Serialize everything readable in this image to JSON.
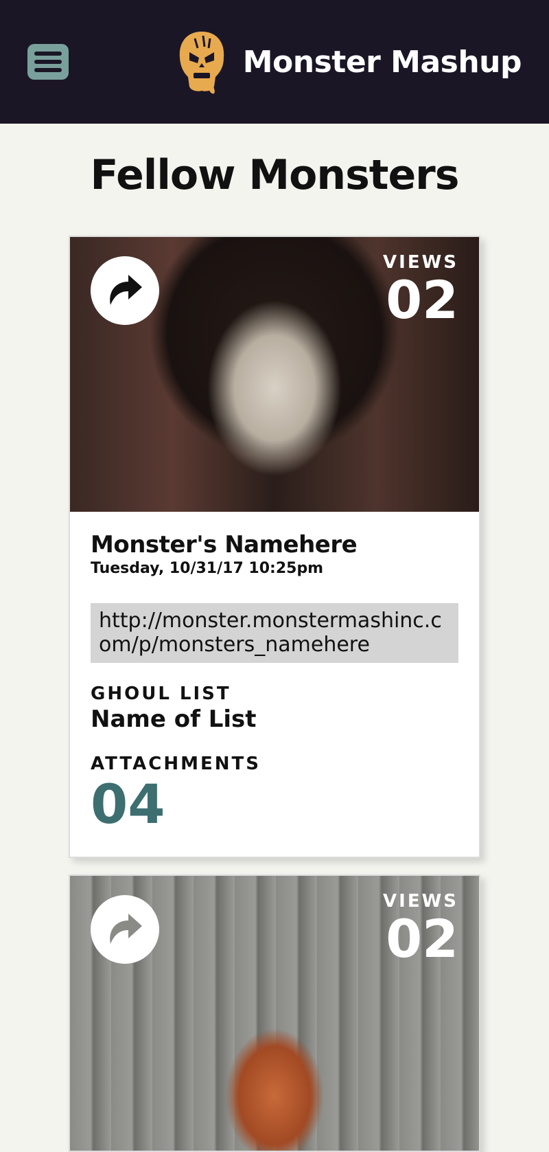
{
  "header": {
    "brand_name": "Monster Mashup",
    "logo_icon": "skull-logo-icon",
    "menu_icon": "hamburger-menu-icon",
    "colors": {
      "bar": "#1a1626",
      "menu": "#7aa09c",
      "logo": "#e7aa4e"
    }
  },
  "page": {
    "title": "Fellow Monsters"
  },
  "cards": [
    {
      "share_icon": "share-arrow-icon",
      "views_label": "VIEWS",
      "views_count": "02",
      "name": "Monster's Namehere",
      "date": "Tuesday, 10/31/17 10:25pm",
      "url": "http://monster.monstermashinc.com/p/monsters_namehere",
      "ghoul_list_label": "GHOUL LIST",
      "ghoul_list_name": "Name of List",
      "attachments_label": "ATTACHMENTS",
      "attachments_count": "04",
      "accent_color": "#3d6e70"
    },
    {
      "share_icon": "share-arrow-icon",
      "views_label": "VIEWS",
      "views_count": "02"
    }
  ]
}
